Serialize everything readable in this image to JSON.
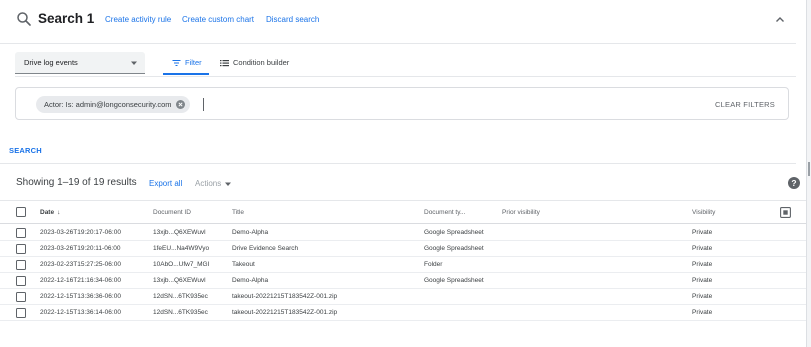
{
  "search": {
    "title": "Search 1",
    "links": [
      "Create activity rule",
      "Create custom chart",
      "Discard search"
    ],
    "icon": "search-icon",
    "collapse_icon": "chevron-up-icon"
  },
  "filter": {
    "source_select": "Drive log events",
    "tabs": [
      {
        "label": "Filter",
        "icon": "filter-icon",
        "active": true
      },
      {
        "label": "Condition builder",
        "icon": "list-icon",
        "active": false
      }
    ],
    "chip": "Actor: Is: admin@longconsecurity.com",
    "clear_label": "CLEAR FILTERS",
    "search_button": "SEARCH"
  },
  "results": {
    "showing": "Showing 1–19 of 19 results",
    "export_all": "Export all",
    "actions": "Actions",
    "columns": [
      "Date",
      "Document ID",
      "Title",
      "Document ty...",
      "Prior visibility",
      "Visibility"
    ],
    "rows": [
      {
        "date": "2023-03-26T19:20:17-06:00",
        "doc_id": "13xjb...Q6XEWuvl",
        "title": "Demo-Alpha",
        "doc_type": "Google Spreadsheet",
        "prior": "",
        "visibility": "Private"
      },
      {
        "date": "2023-03-26T19:20:11-06:00",
        "doc_id": "1feEU...Na4W9Vyo",
        "title": "Drive Evidence Search",
        "doc_type": "Google Spreadsheet",
        "prior": "",
        "visibility": "Private"
      },
      {
        "date": "2023-02-23T15:27:25-06:00",
        "doc_id": "10AbO...Ufw7_MGI",
        "title": "Takeout",
        "doc_type": "Folder",
        "prior": "",
        "visibility": "Private"
      },
      {
        "date": "2022-12-16T21:16:34-06:00",
        "doc_id": "13xjb...Q6XEWuvl",
        "title": "Demo-Alpha",
        "doc_type": "Google Spreadsheet",
        "prior": "",
        "visibility": "Private"
      },
      {
        "date": "2022-12-15T13:36:36-06:00",
        "doc_id": "12dSN...6TK935ec",
        "title": "takeout-20221215T183542Z-001.zip",
        "doc_type": "",
        "prior": "",
        "visibility": "Private"
      },
      {
        "date": "2022-12-15T13:36:14-06:00",
        "doc_id": "12dSN...6TK935ec",
        "title": "takeout-20221215T183542Z-001.zip",
        "doc_type": "",
        "prior": "",
        "visibility": "Private"
      }
    ]
  },
  "colors": {
    "accent": "#1a73e8",
    "text": "#202124",
    "muted": "#5f6368",
    "chip_bg": "#e8eaed"
  }
}
